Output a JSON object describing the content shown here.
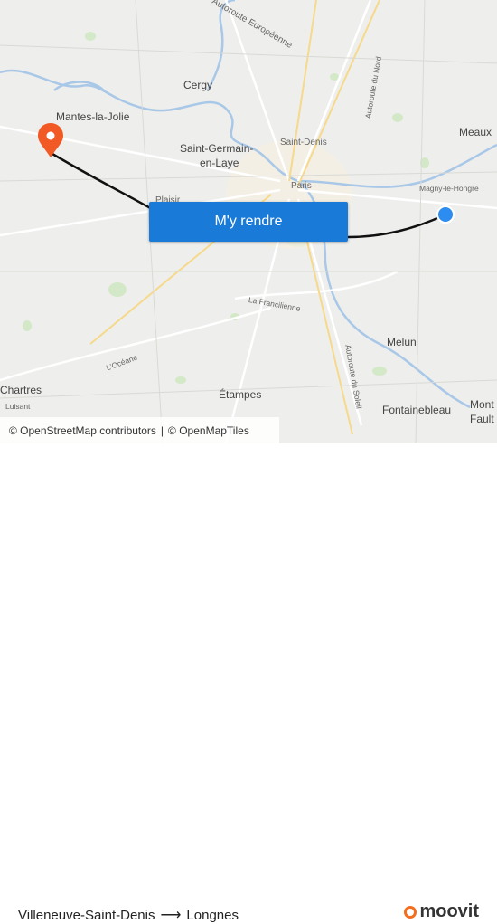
{
  "map": {
    "labels": {
      "europeenne": "Autoroute Européenne",
      "autoroute_nord": "Autoroute du Nord",
      "cergy": "Cergy",
      "meaux": "Meaux",
      "mantes": "Mantes-la-Jolie",
      "saint_denis": "Saint-Denis",
      "saint_germain_1": "Saint-Germain-",
      "saint_germain_2": "en-Laye",
      "paris": "Paris",
      "magny": "Magny-le-Hongre",
      "plaisir": "Plaisir",
      "francilienne": "La Francilienne",
      "oceane": "L'Océane",
      "melun": "Melun",
      "soleil": "Autoroute du Soleil",
      "chartres": "Chartres",
      "luisant": "Luisant",
      "etampes": "Étampes",
      "fontainebleau": "Fontainebleau",
      "montereau_1": "Mont",
      "montereau_2": "Fault"
    },
    "origin_marker_color": "#1a7ad8",
    "destination_marker_color": "#f15a24",
    "route_color": "#111111"
  },
  "cta": {
    "label": "M'y rendre"
  },
  "attribution": {
    "osm_contrib": "© OpenStreetMap contributors",
    "separator": "|",
    "openmaptiles": "© OpenMapTiles"
  },
  "footer": {
    "origin": "Villeneuve-Saint-Denis",
    "arrow": "⟶",
    "destination": "Longnes",
    "brand": "moovit",
    "brand_color": "#f36f20"
  }
}
